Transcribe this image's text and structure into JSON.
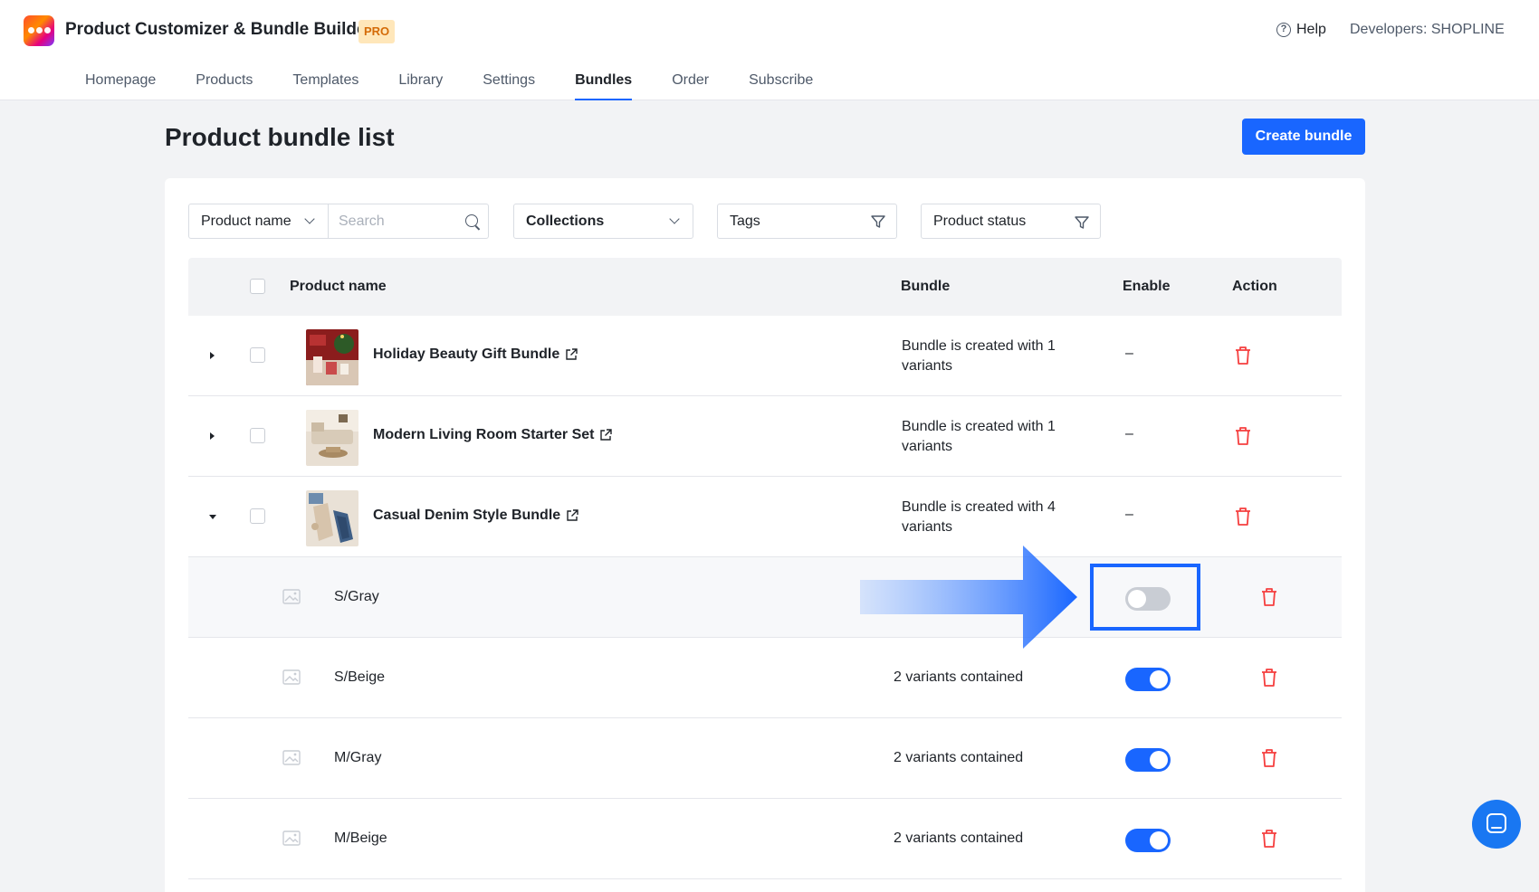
{
  "header": {
    "app_title": "Product Customizer & Bundle Builder",
    "badge": "PRO",
    "help_label": "Help",
    "developers_label": "Developers",
    "developers_sep": ":",
    "developer_name": "SHOPLINE"
  },
  "nav": {
    "items": [
      {
        "label": "Homepage",
        "active": false
      },
      {
        "label": "Products",
        "active": false
      },
      {
        "label": "Templates",
        "active": false
      },
      {
        "label": "Library",
        "active": false
      },
      {
        "label": "Settings",
        "active": false
      },
      {
        "label": "Bundles",
        "active": true
      },
      {
        "label": "Order",
        "active": false
      },
      {
        "label": "Subscribe",
        "active": false
      }
    ]
  },
  "page": {
    "title": "Product bundle list",
    "create_button": "Create bundle"
  },
  "filters": {
    "product_name": "Product name",
    "search_placeholder": "Search",
    "collections": "Collections",
    "tags": "Tags",
    "product_status": "Product status"
  },
  "table": {
    "headers": {
      "product_name": "Product name",
      "bundle": "Bundle",
      "enable": "Enable",
      "action": "Action"
    },
    "products": [
      {
        "name": "Holiday Beauty Gift Bundle",
        "bundle_line1": "Bundle is created with 1",
        "bundle_line2": "variants",
        "enable": "–",
        "expanded": false
      },
      {
        "name": "Modern Living Room Starter Set",
        "bundle_line1": "Bundle is created with 1",
        "bundle_line2": "variants",
        "enable": "–",
        "expanded": false
      },
      {
        "name": "Casual Denim Style Bundle",
        "bundle_line1": "Bundle is created with 4",
        "bundle_line2": "variants",
        "enable": "–",
        "expanded": true
      }
    ],
    "variants": [
      {
        "name": "S/Gray",
        "bundle": "",
        "enabled": false
      },
      {
        "name": "S/Beige",
        "bundle": "2 variants contained",
        "enabled": true
      },
      {
        "name": "M/Gray",
        "bundle": "2 variants contained",
        "enabled": true
      },
      {
        "name": "M/Beige",
        "bundle": "2 variants contained",
        "enabled": true
      }
    ]
  },
  "colors": {
    "accent": "#1966ff",
    "danger": "#f53f3f",
    "badge_bg": "#ffe7ba",
    "badge_text": "#d46b08"
  },
  "icons": [
    "app-logo",
    "help-icon",
    "chevron-down-icon",
    "search-icon",
    "filter-icon",
    "external-link-icon",
    "trash-icon",
    "image-placeholder-icon",
    "caret-right-icon",
    "caret-down-icon",
    "chat-icon",
    "arrow-right-icon"
  ]
}
